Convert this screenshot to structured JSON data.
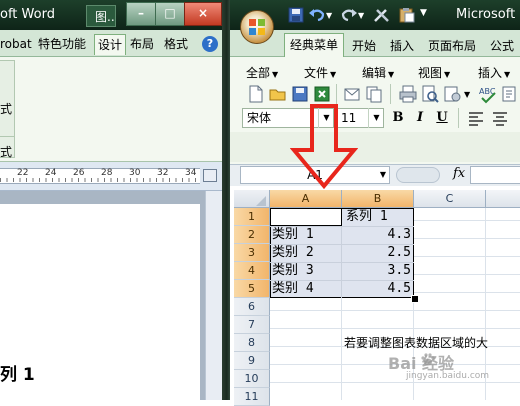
{
  "word": {
    "window_title": "oft Word",
    "doc_tab": "图..",
    "tabs": [
      "robat",
      "特色功能",
      "设计",
      "布局",
      "格式"
    ],
    "help": "?",
    "group_labels": [
      "式",
      "式"
    ],
    "ruler_numbers": [
      "22",
      "24",
      "26",
      "28",
      "30",
      "32",
      "34"
    ],
    "heading_text": "列 1"
  },
  "excel": {
    "window_title": "Microsoft",
    "tabs": {
      "classic": "经典菜单",
      "start": "开始",
      "insert": "插入",
      "layout": "页面布局",
      "formula": "公式"
    },
    "menus": {
      "all": "全部",
      "file": "文件",
      "edit": "编辑",
      "view": "视图",
      "insert": "插入"
    },
    "font_name": "宋体",
    "font_size": "11",
    "format_buttons": {
      "bold": "B",
      "italic": "I",
      "underline": "U"
    },
    "name_box": "A1",
    "fx": "fx",
    "columns": [
      "A",
      "B",
      "C"
    ],
    "rows": [
      "1",
      "2",
      "3",
      "4",
      "5",
      "6",
      "7",
      "8",
      "9",
      "10",
      "11"
    ],
    "cells": {
      "b1": "系列 1",
      "a2": "类别 1",
      "b2": "4.3",
      "a3": "类别 2",
      "b3": "2.5",
      "a4": "类别 3",
      "b4": "3.5",
      "a5": "类别 4",
      "b5": "4.5",
      "c8": "若要调整图表数据区域的大"
    }
  },
  "watermark": {
    "text": "Bai  经验",
    "sub": "jingyan.baidu.com"
  },
  "colors": {
    "titlebar": "#1d3f2a",
    "ribbon_tab_bg": "#d4e6d6",
    "selected_header": "#f2b56b",
    "selection_fill": "#dfe4ef",
    "arrow": "#e8261c"
  },
  "icons": [
    "office-button-icon",
    "save-icon",
    "undo-icon",
    "redo-icon",
    "new-doc-icon",
    "open-folder-icon",
    "print-icon",
    "print-preview-icon",
    "spell-check-icon",
    "fx-icon",
    "red-down-arrow-icon"
  ]
}
